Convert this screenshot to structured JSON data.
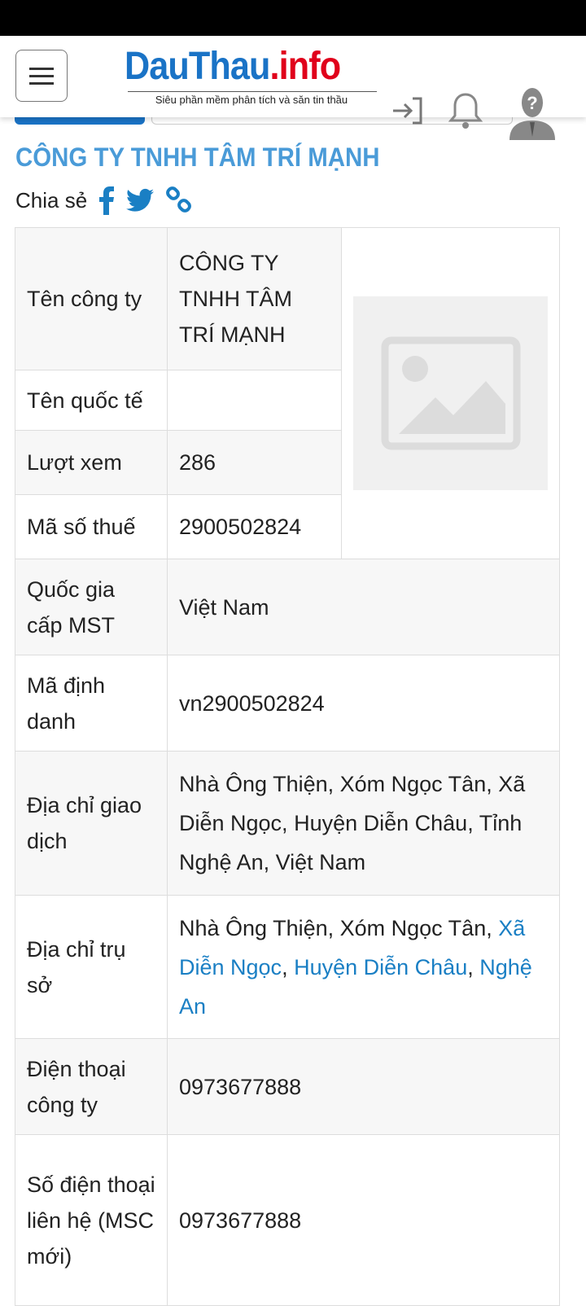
{
  "header": {
    "logo_main": "DauThau",
    "logo_dot": ".",
    "logo_suffix": "info",
    "logo_tagline": "Siêu phần mềm phân tích và săn tin thầu"
  },
  "title": "CÔNG TY TNHH TÂM TRÍ MẠNH",
  "share_label": "Chia sẻ",
  "colors": {
    "brand_blue": "#1a73c6",
    "brand_red": "#e0001b",
    "title_blue": "#4a9bd8",
    "link_blue": "#1a7fc4"
  },
  "rows": [
    {
      "label": "Tên công ty",
      "value": "CÔNG TY TNHH TÂM TRÍ MẠNH"
    },
    {
      "label": "Tên quốc tế",
      "value": ""
    },
    {
      "label": "Lượt xem",
      "value": "286"
    },
    {
      "label": "Mã số thuế",
      "value": "2900502824"
    },
    {
      "label": "Quốc gia cấp MST",
      "value": "Việt Nam"
    },
    {
      "label": "Mã định danh",
      "value": "vn2900502824"
    },
    {
      "label": "Địa chỉ giao dịch",
      "value": "Nhà Ông Thiện, Xóm Ngọc Tân, Xã Diễn Ngọc, Huyện Diễn Châu, Tỉnh Nghệ An, Việt Nam"
    },
    {
      "label": "Địa chỉ trụ sở",
      "value_prefix": "Nhà Ông Thiện, Xóm Ngọc Tân,",
      "links": [
        "Xã Diễn Ngọc",
        "Huyện Diễn Châu",
        "Nghệ An"
      ],
      "sep": ", "
    },
    {
      "label": "Điện thoại công ty",
      "value": "0973677888"
    },
    {
      "label": "Số điện thoại liên hệ (MSC mới)",
      "value": "0973677888"
    }
  ]
}
